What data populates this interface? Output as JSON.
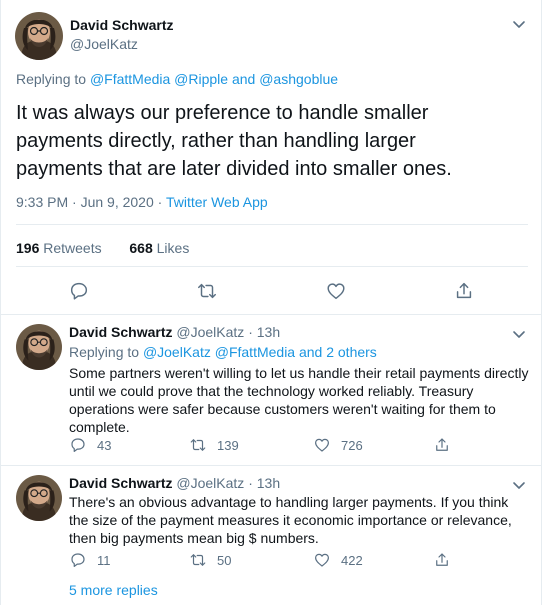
{
  "main_tweet": {
    "author_name": "David Schwartz",
    "author_handle": "@JoelKatz",
    "replying_prefix": "Replying to",
    "replying_to": "@FfattMedia @Ripple and @ashgoblue",
    "text": "It was always our preference to handle smaller\npayments directly, rather than handling larger\npayments that are later divided into smaller ones.",
    "time": "9:33 PM · Jun 9, 2020",
    "separator": "·",
    "source": "Twitter Web App",
    "retweets_count": "196",
    "retweets_label": "Retweets",
    "likes_count": "668",
    "likes_label": "Likes"
  },
  "replies": [
    {
      "author_name": "David Schwartz",
      "author_handle": "@JoelKatz",
      "separator": "·",
      "time": "13h",
      "replying_prefix": "Replying to",
      "replying_to": "@JoelKatz @FfattMedia and 2 others",
      "text": "Some partners weren't willing to let us handle their retail payments directly until we could prove that the technology worked reliably. Treasury operations were safer because customers weren't waiting for them to complete.",
      "reply_count": "43",
      "retweet_count": "139",
      "like_count": "726"
    },
    {
      "author_name": "David Schwartz",
      "author_handle": "@JoelKatz",
      "separator": "·",
      "time": "13h",
      "text": "There's an obvious advantage to handling larger payments. If you think the size of the payment measures it economic importance or relevance, then big payments mean big $ numbers.",
      "reply_count": "11",
      "retweet_count": "50",
      "like_count": "422"
    }
  ],
  "more_replies": "5 more replies",
  "colors": {
    "link": "#1b95e0",
    "muted": "#5b7083",
    "text": "#0f1419",
    "divider": "#e6ecf0"
  },
  "icons": [
    "chevron-down-icon",
    "reply-icon",
    "retweet-icon",
    "like-icon",
    "share-icon"
  ]
}
